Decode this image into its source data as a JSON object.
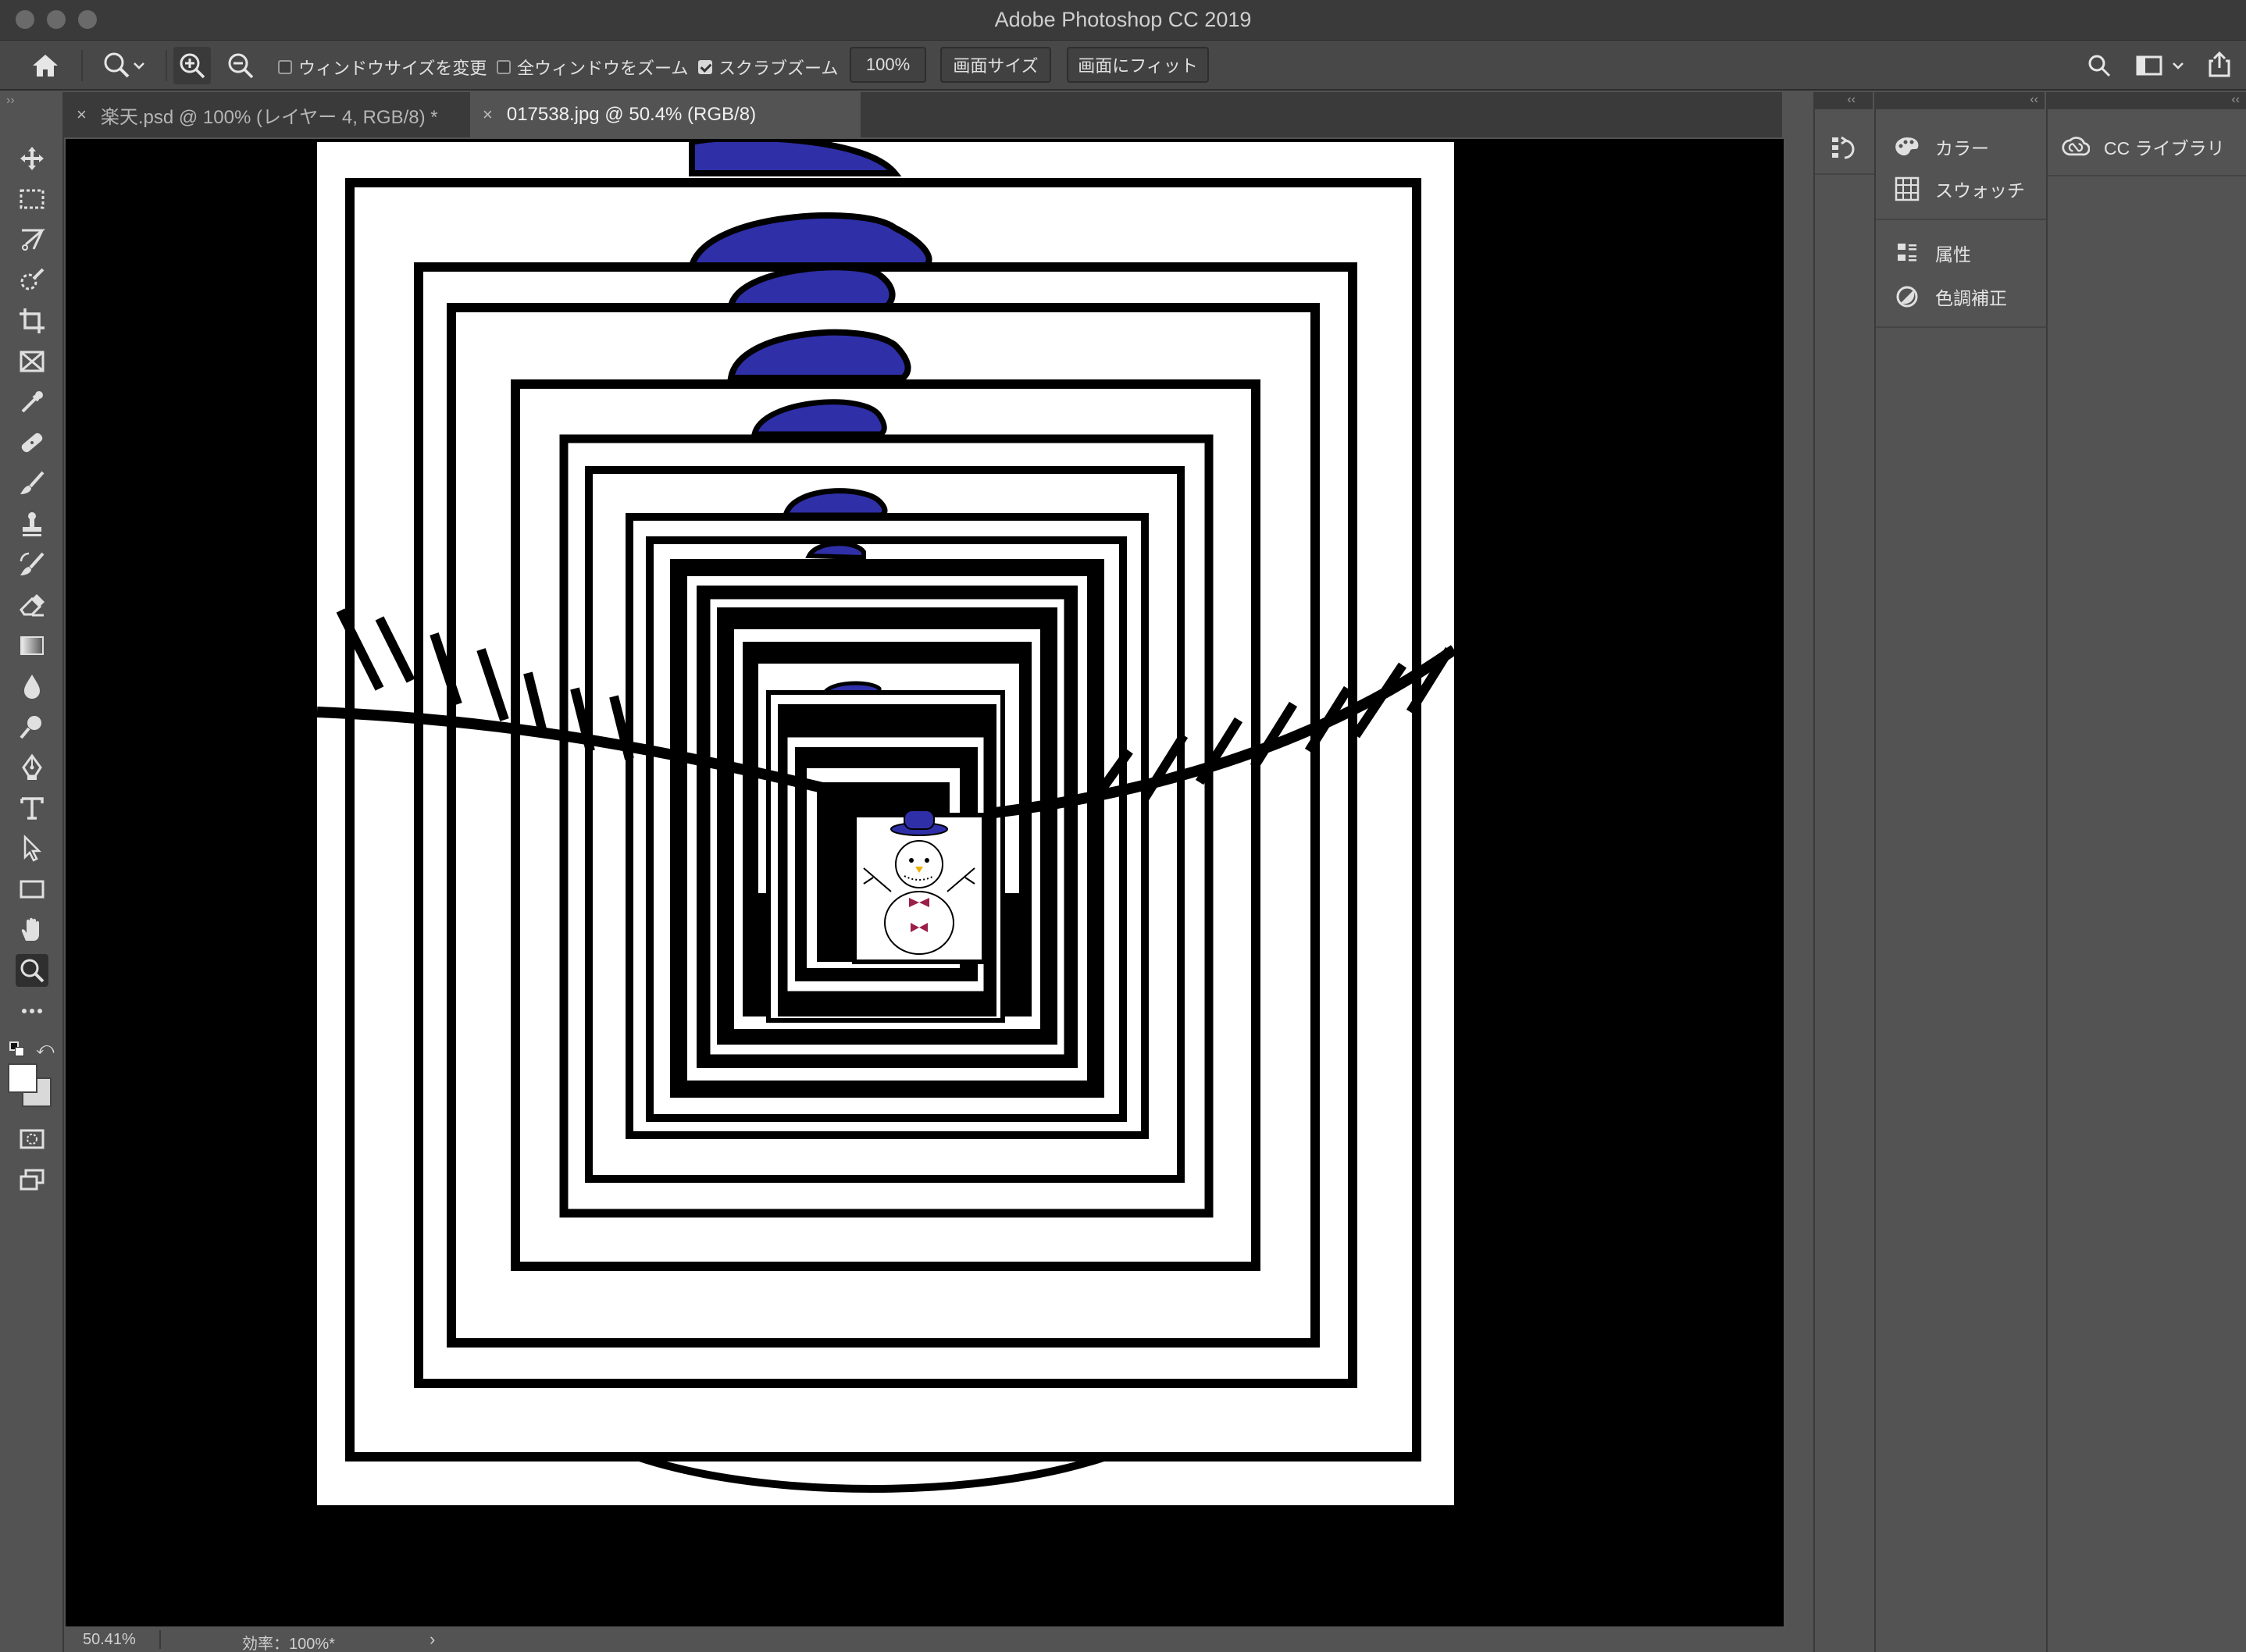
{
  "window": {
    "title": "Adobe Photoshop CC 2019"
  },
  "options": {
    "resize_windows_label": "ウィンドウサイズを変更",
    "resize_windows_checked": false,
    "zoom_all_label": "全ウィンドウをズーム",
    "zoom_all_checked": false,
    "scrubby_zoom_label": "スクラブズーム",
    "scrubby_zoom_checked": true,
    "zoom_100_label": "100%",
    "fit_screen_label": "画面サイズ",
    "fill_screen_label": "画面にフィット"
  },
  "tabs": [
    {
      "label": "楽天.psd @ 100% (レイヤー 4, RGB/8) *",
      "close": "×",
      "active": false
    },
    {
      "label": "017538.jpg @ 50.4% (RGB/8)",
      "close": "×",
      "active": true
    }
  ],
  "status": {
    "zoom": "50.41%",
    "efficiency": "効率：100%*",
    "arrow": "›"
  },
  "panels": {
    "color": "カラー",
    "swatches": "スウォッチ",
    "properties": "属性",
    "adjustments": "色調補正",
    "libraries": "CC ライブラリ"
  },
  "colors": {
    "hat_blue": "#2f2fa8",
    "panel_bg": "#535353",
    "bar_bg": "#3a3a3a",
    "bowtie": "#9b1f4b"
  },
  "icons": {
    "tools": [
      "move-icon",
      "marquee-icon",
      "lasso-icon",
      "quick-select-icon",
      "crop-icon",
      "frame-icon",
      "eyedropper-icon",
      "healing-icon",
      "brush-icon",
      "stamp-icon",
      "history-brush-icon",
      "eraser-icon",
      "gradient-icon",
      "blur-icon",
      "dodge-icon",
      "pen-icon",
      "type-icon",
      "path-select-icon",
      "rectangle-icon",
      "hand-icon",
      "zoom-icon",
      "more-icon"
    ]
  }
}
